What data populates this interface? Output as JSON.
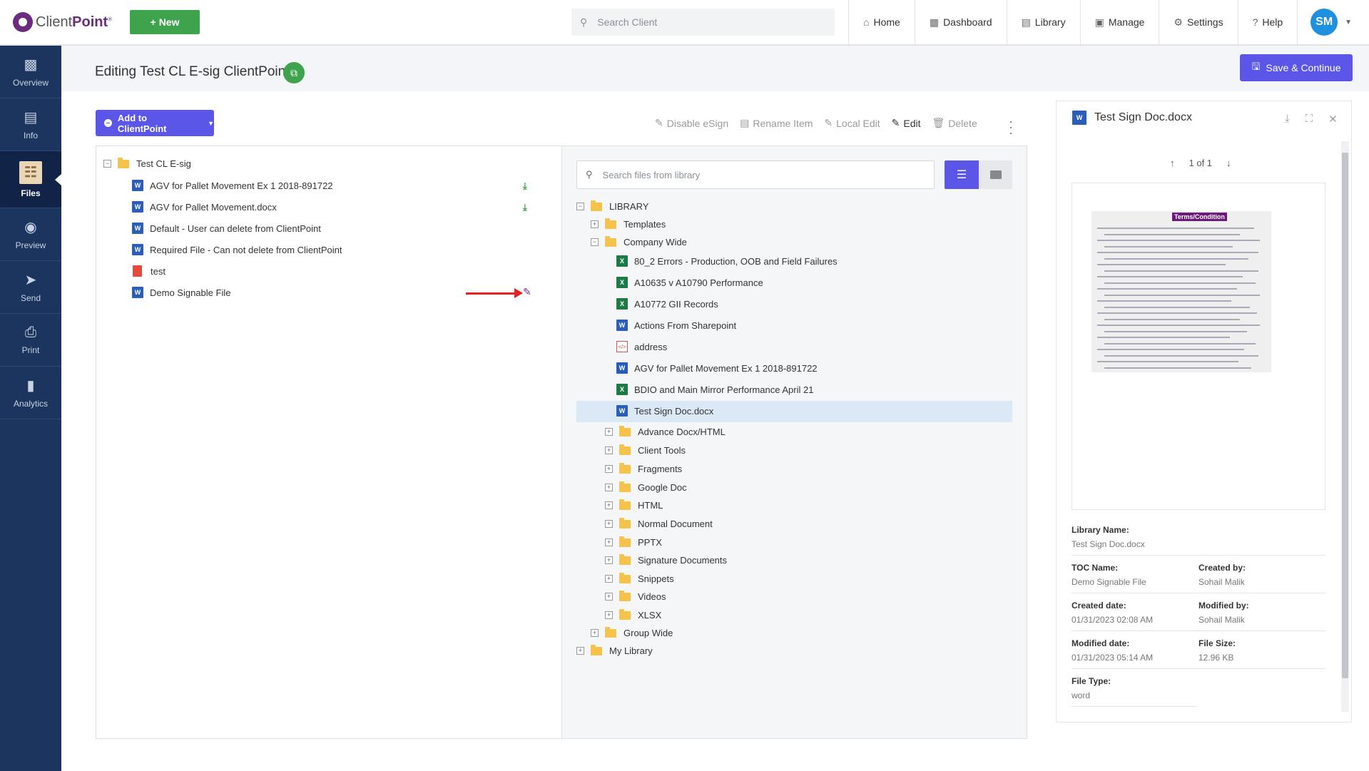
{
  "app": {
    "brand_light": "Client",
    "brand_bold": "Point",
    "new_label": "New",
    "search_placeholder": "Search Client"
  },
  "nav": [
    {
      "label": "Home",
      "icon": "home-icon"
    },
    {
      "label": "Dashboard",
      "icon": "dashboard-icon"
    },
    {
      "label": "Library",
      "icon": "library-icon"
    },
    {
      "label": "Manage",
      "icon": "manage-icon"
    },
    {
      "label": "Settings",
      "icon": "gear-icon"
    },
    {
      "label": "Help",
      "icon": "help-icon"
    }
  ],
  "user": {
    "initials": "SM"
  },
  "sidebar": [
    {
      "label": "Overview",
      "icon": "chart-icon"
    },
    {
      "label": "Info",
      "icon": "info-card-icon"
    },
    {
      "label": "Files",
      "icon": "file-icon",
      "active": true
    },
    {
      "label": "Preview",
      "icon": "eye-icon"
    },
    {
      "label": "Send",
      "icon": "send-icon"
    },
    {
      "label": "Print",
      "icon": "print-icon"
    },
    {
      "label": "Analytics",
      "icon": "analytics-icon"
    }
  ],
  "page": {
    "title": "Editing Test CL E-sig ClientPoint",
    "save_label": "Save & Continue",
    "add_label": "Add to ClientPoint"
  },
  "toolbar": {
    "disable_esign": "Disable eSign",
    "rename": "Rename Item",
    "local_edit": "Local Edit",
    "edit": "Edit",
    "delete": "Delete"
  },
  "toc": {
    "root": "Test CL E-sig",
    "items": [
      {
        "label": "AGV for Pallet Movement Ex 1 2018-891722",
        "type": "word",
        "download": true
      },
      {
        "label": "AGV for Pallet Movement.docx",
        "type": "word",
        "download": true
      },
      {
        "label": "Default - User can delete from ClientPoint",
        "type": "word"
      },
      {
        "label": "Required File - Can not delete from ClientPoint",
        "type": "word"
      },
      {
        "label": "test",
        "type": "pdf"
      },
      {
        "label": "Demo Signable File",
        "type": "word",
        "editing": true
      }
    ]
  },
  "library": {
    "search_placeholder": "Search files from library",
    "root": "LIBRARY",
    "templates": "Templates",
    "company_wide": "Company Wide",
    "files": [
      {
        "label": "80_2 Errors - Production, OOB and Field Failures",
        "type": "excel"
      },
      {
        "label": "A10635 v A10790 Performance",
        "type": "excel"
      },
      {
        "label": "A10772 GII Records",
        "type": "excel"
      },
      {
        "label": "Actions From Sharepoint",
        "type": "word"
      },
      {
        "label": "address",
        "type": "code"
      },
      {
        "label": "AGV for Pallet Movement Ex 1 2018-891722",
        "type": "word"
      },
      {
        "label": "BDIO and Main Mirror Performance April 21",
        "type": "excel"
      },
      {
        "label": "Test Sign Doc.docx",
        "type": "word",
        "selected": true
      }
    ],
    "subfolders": [
      "Advance Docx/HTML",
      "Client Tools",
      "Fragments",
      "Google Doc",
      "HTML",
      "Normal Document",
      "PPTX",
      "Signature Documents",
      "Snippets",
      "Videos",
      "XLSX"
    ],
    "group_wide": "Group Wide",
    "my_library": "My Library"
  },
  "preview": {
    "title": "Test Sign Doc.docx",
    "page_indicator": "1 of 1",
    "doc_heading": "Terms/Condition",
    "library_name_label": "Library Name:",
    "library_name": "Test Sign Doc.docx",
    "toc_name_label": "TOC Name:",
    "toc_name": "Demo Signable File",
    "created_by_label": "Created by:",
    "created_by": "Sohail Malik",
    "created_date_label": "Created date:",
    "created_date": "01/31/2023 02:08 AM",
    "modified_by_label": "Modified by:",
    "modified_by": "Sohail Malik",
    "modified_date_label": "Modified date:",
    "modified_date": "01/31/2023 05:14 AM",
    "file_size_label": "File Size:",
    "file_size": "12.96 KB",
    "file_type_label": "File Type:",
    "file_type": "word"
  },
  "colors": {
    "accent": "#5b55e8",
    "green": "#3fa34d",
    "sidebar": "#1c355e",
    "brand": "#6b2c7d",
    "arrow": "#e82020"
  }
}
